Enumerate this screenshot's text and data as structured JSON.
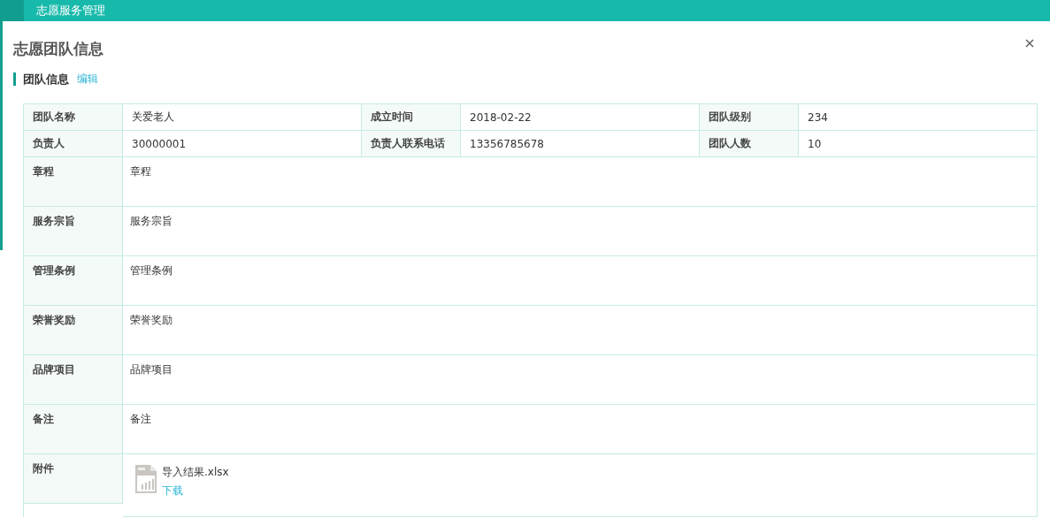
{
  "top_bar": {
    "title": "志愿服务管理"
  },
  "dialog": {
    "title": "志愿团队信息",
    "section": {
      "title": "团队信息",
      "edit_link": "编辑"
    }
  },
  "summary_rows": [
    [
      {
        "label": "团队名称",
        "value": "关爱老人"
      },
      {
        "label": "成立时间",
        "value": "2018-02-22"
      },
      {
        "label": "团队级别",
        "value": "234"
      }
    ],
    [
      {
        "label": "负责人",
        "value": "30000001"
      },
      {
        "label": "负责人联系电话",
        "value": "13356785678"
      },
      {
        "label": "团队人数",
        "value": "10"
      }
    ]
  ],
  "detail_rows": [
    {
      "kind": "text",
      "label": "章程",
      "value": "章程"
    },
    {
      "kind": "text",
      "label": "服务宗旨",
      "value": "服务宗旨"
    },
    {
      "kind": "text",
      "label": "管理条例",
      "value": "管理条例"
    },
    {
      "kind": "text",
      "label": "荣誉奖励",
      "value": "荣誉奖励"
    },
    {
      "kind": "text",
      "label": "品牌项目",
      "value": "品牌项目"
    },
    {
      "kind": "text",
      "label": "备注",
      "value": "备注"
    },
    {
      "kind": "file",
      "label": "附件",
      "file_name": "导入结果.xlsx",
      "download": "下载"
    }
  ]
}
